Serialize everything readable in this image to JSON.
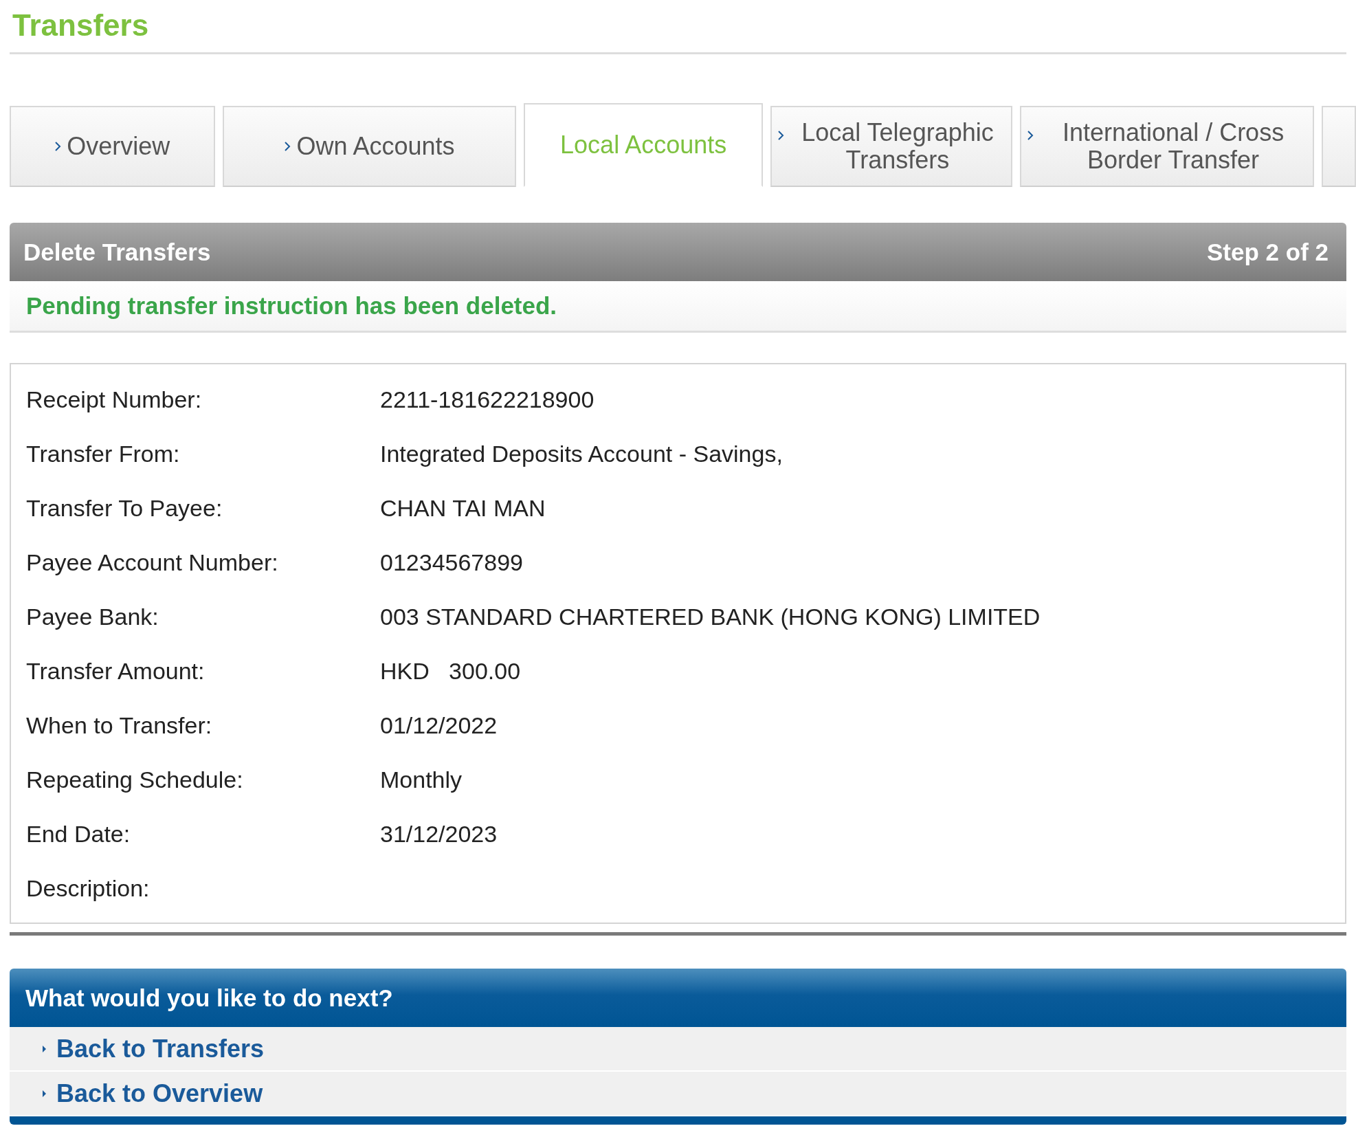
{
  "page": {
    "title": "Transfers"
  },
  "tabs": [
    {
      "label": "Overview",
      "selected": false
    },
    {
      "label": "Own Accounts",
      "selected": false
    },
    {
      "label": "Local Accounts",
      "selected": true
    },
    {
      "label": "Local Telegraphic Transfers",
      "selected": false
    },
    {
      "label": "International / Cross Border Transfer",
      "selected": false
    }
  ],
  "panel": {
    "title": "Delete Transfers",
    "step": "Step 2 of 2",
    "message": "Pending transfer instruction has been deleted."
  },
  "details": [
    {
      "label": "Receipt Number:",
      "value": "2211-181622218900"
    },
    {
      "label": "Transfer From:",
      "value": "Integrated Deposits Account - Savings,"
    },
    {
      "label": "Transfer To Payee:",
      "value": "CHAN TAI MAN"
    },
    {
      "label": "Payee Account Number:",
      "value": "01234567899"
    },
    {
      "label": "Payee Bank:",
      "value": "003 STANDARD CHARTERED BANK (HONG KONG) LIMITED"
    },
    {
      "label": "Transfer Amount:",
      "value": "HKD   300.00"
    },
    {
      "label": "When to Transfer:",
      "value": "01/12/2022"
    },
    {
      "label": "Repeating Schedule:",
      "value": "Monthly"
    },
    {
      "label": "End Date:",
      "value": "31/12/2023"
    },
    {
      "label": "Description:"
    }
  ],
  "next": {
    "title": "What would you like to do next?",
    "links": [
      "Back to Transfers",
      "Back to Overview"
    ]
  }
}
